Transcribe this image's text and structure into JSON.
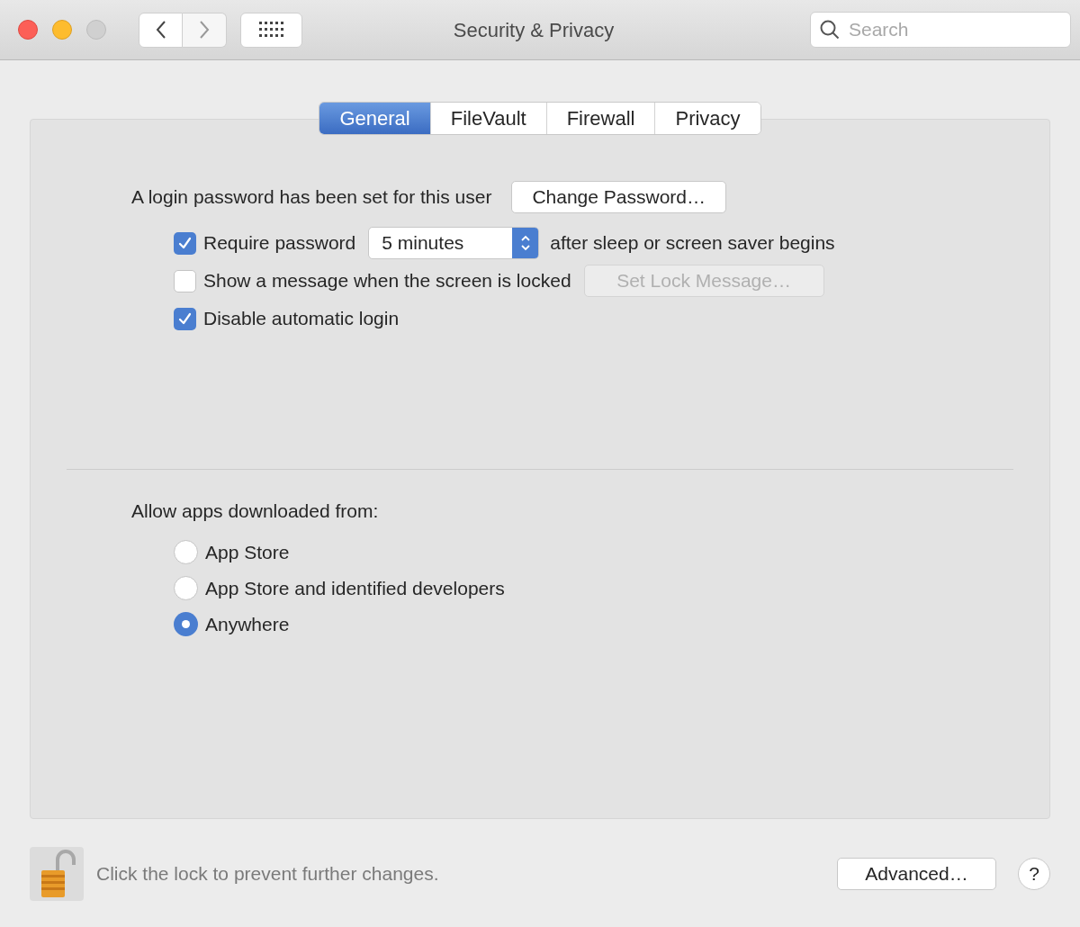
{
  "window": {
    "title": "Security & Privacy"
  },
  "search": {
    "placeholder": "Search"
  },
  "tabs": [
    {
      "label": "General",
      "selected": true
    },
    {
      "label": "FileVault",
      "selected": false
    },
    {
      "label": "Firewall",
      "selected": false
    },
    {
      "label": "Privacy",
      "selected": false
    }
  ],
  "login": {
    "text": "A login password has been set for this user",
    "button": "Change Password…"
  },
  "options": [
    {
      "kind": "select",
      "label": "Require password",
      "checked": true,
      "value": "5 minutes",
      "suffix": "after sleep or screen saver begins"
    },
    {
      "kind": "button",
      "label": "Show a message when the screen is locked",
      "checked": false,
      "button": "Set Lock Message…",
      "disabled": true
    },
    {
      "kind": "plain",
      "label": "Disable automatic login",
      "checked": true
    }
  ],
  "apps": {
    "label": "Allow apps downloaded from:",
    "choices": [
      {
        "label": "App Store",
        "selected": false
      },
      {
        "label": "App Store and identified developers",
        "selected": false
      },
      {
        "label": "Anywhere",
        "selected": true
      }
    ]
  },
  "footer": {
    "lock_text": "Click the lock to prevent further changes.",
    "advanced": "Advanced…",
    "help": "?"
  }
}
